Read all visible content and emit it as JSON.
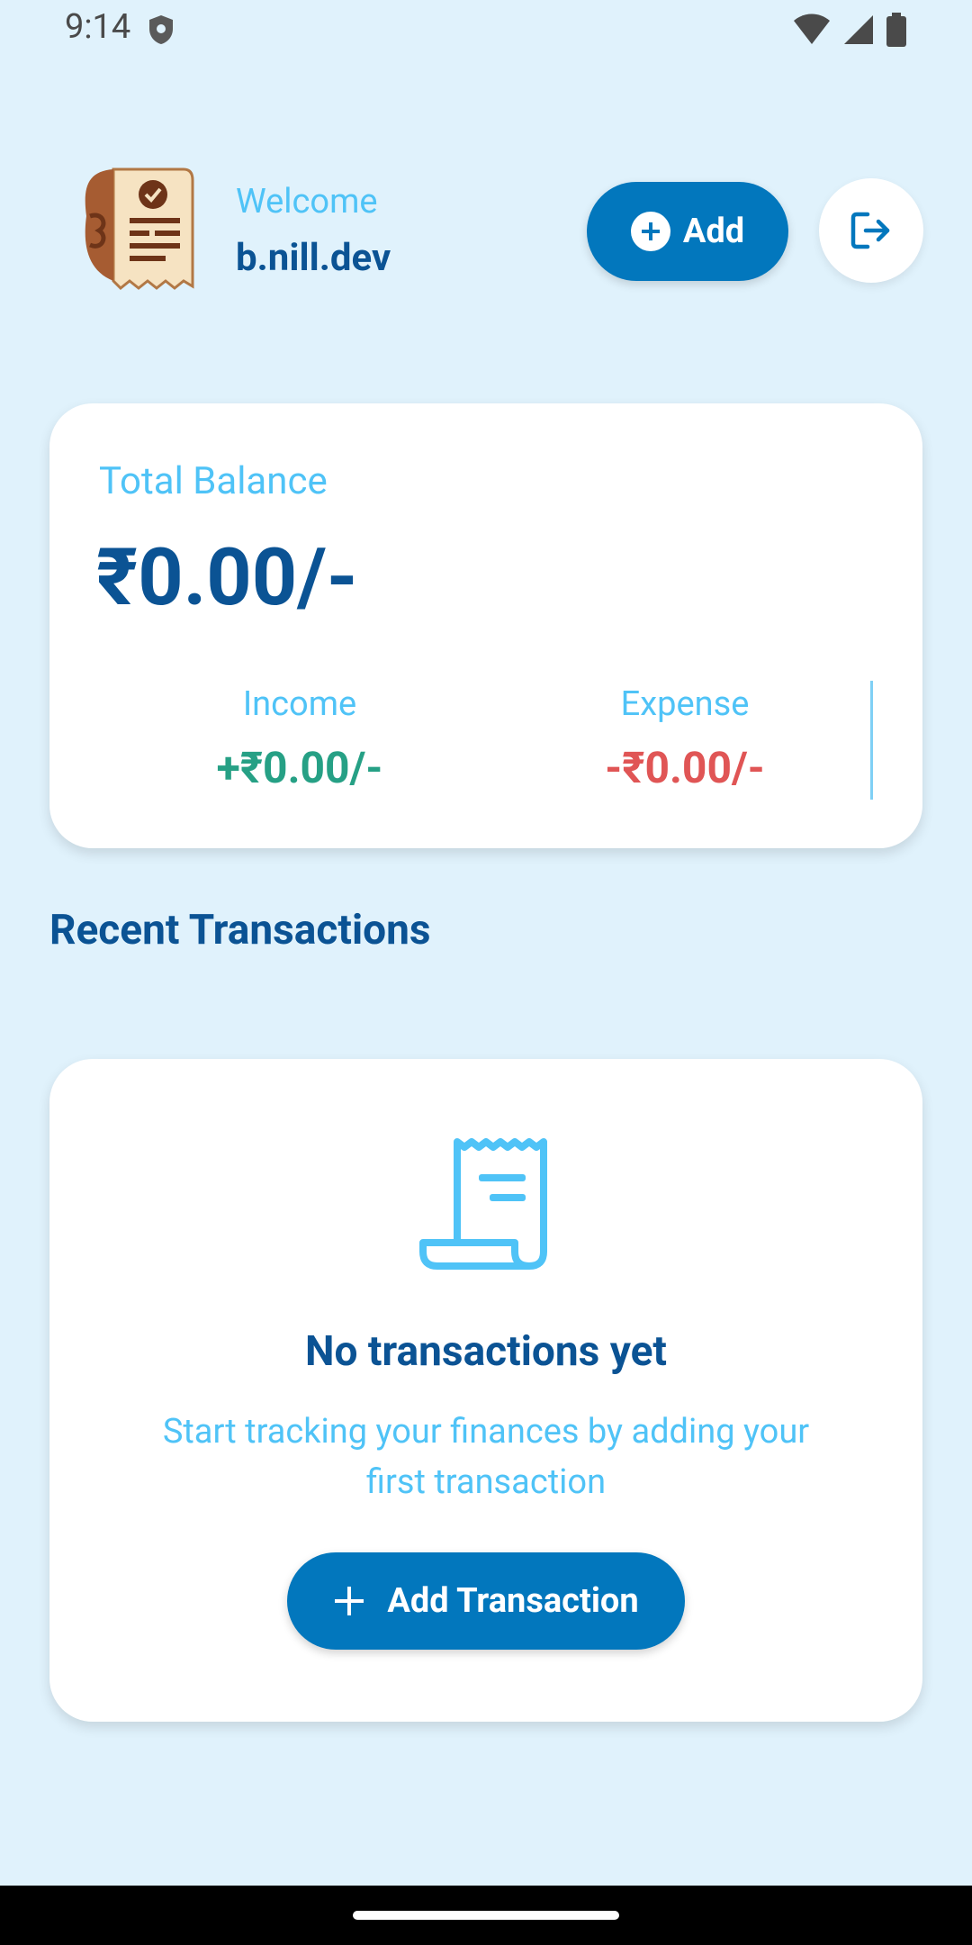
{
  "status_bar": {
    "time": "9:14",
    "icons": [
      "shield-icon",
      "wifi-icon",
      "signal-icon",
      "battery-icon"
    ]
  },
  "header": {
    "welcome": "Welcome",
    "username": "b.nill.dev",
    "add_label": "Add",
    "logo_icon": "receipt-logo-icon",
    "logout_icon": "logout-icon"
  },
  "balance": {
    "label": "Total Balance",
    "amount": "₹0.00/-",
    "income_label": "Income",
    "income_value": "+₹0.00/-",
    "expense_label": "Expense",
    "expense_value": "-₹0.00/-"
  },
  "recent": {
    "title": "Recent Transactions"
  },
  "empty_state": {
    "icon": "receipt-icon",
    "title": "No transactions yet",
    "subtitle": "Start tracking your finances by adding your first transaction",
    "button_label": "Add Transaction"
  },
  "colors": {
    "background": "#e0f2fc",
    "primary": "#0277bd",
    "heading": "#0b5394",
    "accent_light": "#4fc3f7",
    "income": "#26a085",
    "expense": "#e05555"
  }
}
